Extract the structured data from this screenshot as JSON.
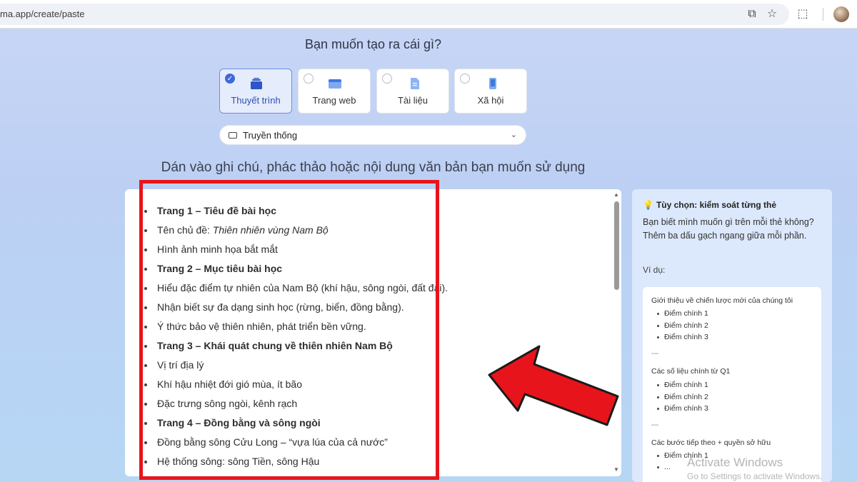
{
  "browser": {
    "url": "ma.app/create/paste"
  },
  "question": "Bạn muốn tạo ra cái gì?",
  "types": [
    {
      "label": "Thuyết trình",
      "selected": true
    },
    {
      "label": "Trang web",
      "selected": false
    },
    {
      "label": "Tài liệu",
      "selected": false
    },
    {
      "label": "Xã hội",
      "selected": false
    }
  ],
  "dropdown": {
    "label": "Truyền thống"
  },
  "instruction": "Dán vào ghi chú, phác thảo hoặc nội dung văn bản bạn muốn sử dụng",
  "editor": {
    "lines": [
      {
        "text": "Trang 1 – Tiêu đề bài học",
        "bold": true
      },
      {
        "prefix": "Tên chủ đề: ",
        "italic": "Thiên nhiên vùng Nam Bộ"
      },
      {
        "text": "Hình ảnh minh họa bắt mắt"
      },
      {
        "text": "Trang 2 – Mục tiêu bài học",
        "bold": true
      },
      {
        "text": "Hiểu đặc điểm tự nhiên của Nam Bộ (khí hậu, sông ngòi, đất đai)."
      },
      {
        "text": "Nhận biết sự đa dạng sinh học (rừng, biển, đồng bằng)."
      },
      {
        "text": "Ý thức bảo vệ thiên nhiên, phát triển bền vững."
      },
      {
        "text": "Trang 3 – Khái quát chung về thiên nhiên Nam Bộ",
        "bold": true
      },
      {
        "text": "Vị trí địa lý"
      },
      {
        "text": "Khí hậu nhiệt đới gió mùa, ít bão"
      },
      {
        "text": "Đặc trưng sông ngòi, kênh rạch"
      },
      {
        "text": "Trang 4 – Đồng bằng và sông ngòi",
        "bold": true
      },
      {
        "text": "Đồng bằng sông Cửu Long – “vựa lúa của cả nước”"
      },
      {
        "text": "Hệ thống sông: sông Tiền, sông Hậu"
      }
    ]
  },
  "side": {
    "title": "Tùy chọn: kiểm soát từng thẻ",
    "description": "Bạn biết mình muốn gì trên mỗi thẻ không? Thêm ba dấu gạch ngang  giữa mỗi phần.",
    "example_label": "Ví dụ:",
    "example": {
      "heading1": "Giới thiệu về chiến lược mới của chúng tôi",
      "items1": [
        "Điểm chính 1",
        "Điểm chính 2",
        "Điểm chính 3"
      ],
      "sep": "---",
      "heading2": "Các số liệu chính từ Q1",
      "items2": [
        "Điểm chính 1",
        "Điểm chính 2",
        "Điểm chính 3"
      ],
      "heading3": "Các bước tiếp theo + quyền sở hữu",
      "items3": [
        "Điểm chính 1",
        "..."
      ]
    }
  },
  "watermark": {
    "title": "Activate Windows",
    "subtitle": "Go to Settings to activate Windows."
  },
  "colors": {
    "highlight_box": "#e8141b",
    "accent": "#3e6ad8"
  }
}
